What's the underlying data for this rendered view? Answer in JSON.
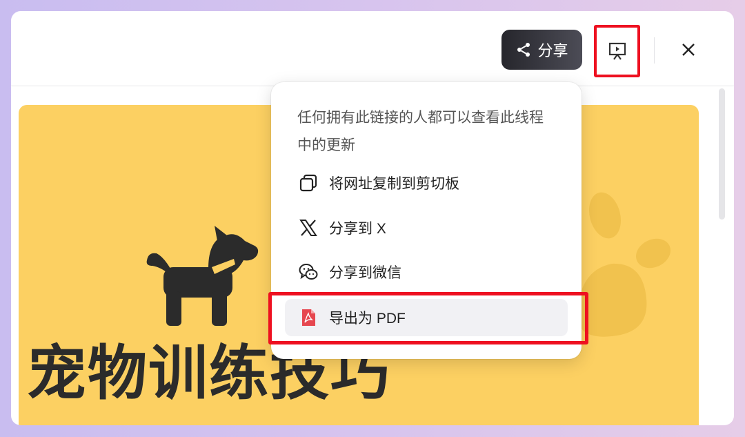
{
  "header": {
    "share_label": "分享"
  },
  "slide": {
    "title": "宠物训练技巧",
    "background_color": "#fcd062"
  },
  "share_menu": {
    "description": "任何拥有此链接的人都可以查看此线程中的更新",
    "items": [
      {
        "label": "将网址复制到剪切板",
        "icon": "copy-icon"
      },
      {
        "label": "分享到 X",
        "icon": "x-logo-icon"
      },
      {
        "label": "分享到微信",
        "icon": "wechat-icon"
      },
      {
        "label": "导出为 PDF",
        "icon": "pdf-icon"
      }
    ]
  },
  "colors": {
    "highlight": "#ee1020",
    "share_button": "#26262c"
  }
}
